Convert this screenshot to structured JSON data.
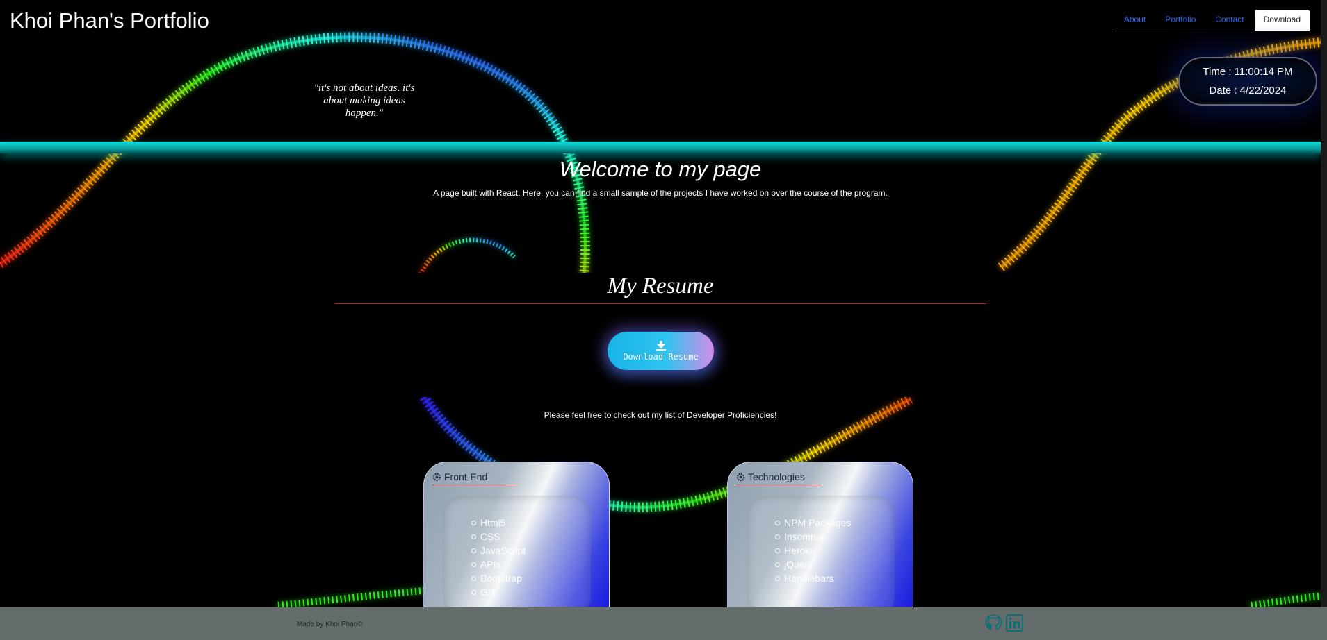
{
  "header": {
    "title": "Khoi Phan's Portfolio"
  },
  "nav": {
    "items": [
      {
        "label": "About"
      },
      {
        "label": "Portfolio"
      },
      {
        "label": "Contact"
      },
      {
        "label": "Download"
      }
    ],
    "active": "Download"
  },
  "clock": {
    "time": "Time : 11:00:14 PM",
    "date": "Date : 4/22/2024"
  },
  "quote": "\"it's not about ideas. it's about making ideas happen.\"",
  "welcome": {
    "title": "Welcome to my page",
    "subtitle": "A page built with React. Here, you can find a small sample of the projects I have worked on over the course of the program."
  },
  "resume": {
    "title": "My Resume",
    "button_label": "Download Resume",
    "button_icon": "download-icon"
  },
  "proficiencies_text": "Please feel free to check out my list of Developer Proficiencies!",
  "cards": [
    {
      "title": "Front-End",
      "icon": "gear-icon",
      "items": [
        "Html5",
        "CSS",
        "JavaScript",
        "APIs",
        "Bootstrap",
        "GIT"
      ]
    },
    {
      "title": "Technologies",
      "icon": "gear-icon",
      "items": [
        "NPM Packages",
        "Insomnia",
        "Heroku",
        "jQuery",
        "Handlebars"
      ]
    }
  ],
  "footer": {
    "text": "Made by Khoi Phan©",
    "icons": [
      "github-icon",
      "linkedin-icon"
    ]
  },
  "colors": {
    "accent_cyan": "#11dddd",
    "nav_link": "#2b6fff",
    "footer_bg": "#646c6c",
    "underline_red": "#c81e1e"
  }
}
